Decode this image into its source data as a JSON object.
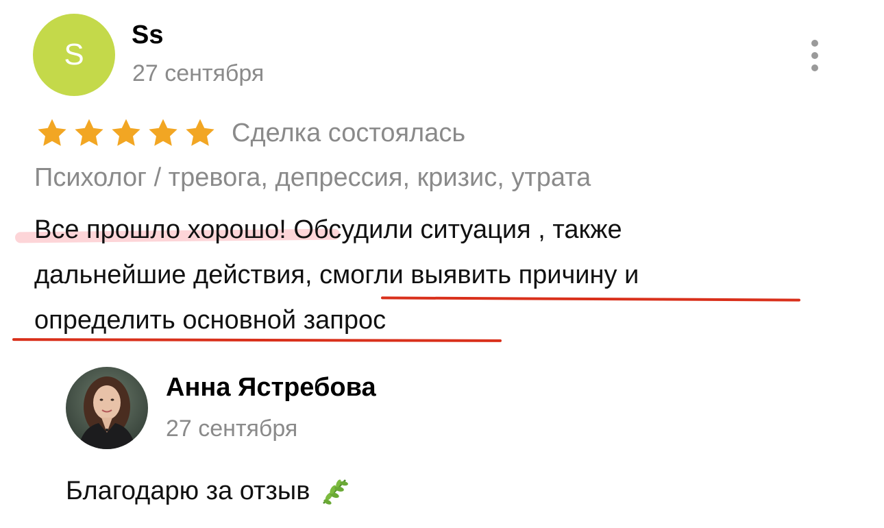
{
  "review": {
    "author": {
      "initial": "S",
      "name": "Ss",
      "date": "27 сентября",
      "avatar_color": "#c4d94a"
    },
    "rating": 5,
    "max_rating": 5,
    "star_color": "#f2a623",
    "deal_status": "Сделка состоялась",
    "service": "Психолог / тревога, депрессия, кризис, утрата",
    "text_lines": [
      "Все прошло хорошо! Обсудили ситуация , также",
      "дальнейшие действия, смогли выявить причину и",
      "определить основной запрос"
    ],
    "annotations": {
      "highlight_color": "#fdd5d8",
      "underline_color": "#d9301b"
    },
    "menu_icon": "more-vertical-icon"
  },
  "reply": {
    "author": {
      "name": "Анна Ястребова",
      "date": "27 сентября"
    },
    "text": "Благодарю за отзыв",
    "emoji_icon": "herb-leaf-icon"
  }
}
